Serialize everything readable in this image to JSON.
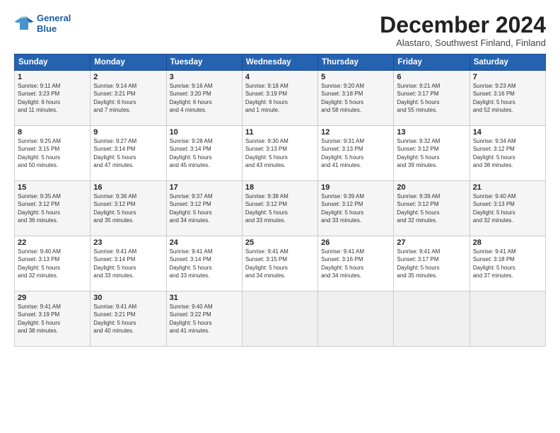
{
  "logo": {
    "line1": "General",
    "line2": "Blue"
  },
  "title": "December 2024",
  "subtitle": "Alastaro, Southwest Finland, Finland",
  "weekdays": [
    "Sunday",
    "Monday",
    "Tuesday",
    "Wednesday",
    "Thursday",
    "Friday",
    "Saturday"
  ],
  "weeks": [
    [
      {
        "day": "1",
        "info": "Sunrise: 9:11 AM\nSunset: 3:23 PM\nDaylight: 6 hours\nand 11 minutes."
      },
      {
        "day": "2",
        "info": "Sunrise: 9:14 AM\nSunset: 3:21 PM\nDaylight: 6 hours\nand 7 minutes."
      },
      {
        "day": "3",
        "info": "Sunrise: 9:16 AM\nSunset: 3:20 PM\nDaylight: 6 hours\nand 4 minutes."
      },
      {
        "day": "4",
        "info": "Sunrise: 9:18 AM\nSunset: 3:19 PM\nDaylight: 6 hours\nand 1 minute."
      },
      {
        "day": "5",
        "info": "Sunrise: 9:20 AM\nSunset: 3:18 PM\nDaylight: 5 hours\nand 58 minutes."
      },
      {
        "day": "6",
        "info": "Sunrise: 9:21 AM\nSunset: 3:17 PM\nDaylight: 5 hours\nand 55 minutes."
      },
      {
        "day": "7",
        "info": "Sunrise: 9:23 AM\nSunset: 3:16 PM\nDaylight: 5 hours\nand 52 minutes."
      }
    ],
    [
      {
        "day": "8",
        "info": "Sunrise: 9:25 AM\nSunset: 3:15 PM\nDaylight: 5 hours\nand 50 minutes."
      },
      {
        "day": "9",
        "info": "Sunrise: 9:27 AM\nSunset: 3:14 PM\nDaylight: 5 hours\nand 47 minutes."
      },
      {
        "day": "10",
        "info": "Sunrise: 9:28 AM\nSunset: 3:14 PM\nDaylight: 5 hours\nand 45 minutes."
      },
      {
        "day": "11",
        "info": "Sunrise: 9:30 AM\nSunset: 3:13 PM\nDaylight: 5 hours\nand 43 minutes."
      },
      {
        "day": "12",
        "info": "Sunrise: 9:31 AM\nSunset: 3:13 PM\nDaylight: 5 hours\nand 41 minutes."
      },
      {
        "day": "13",
        "info": "Sunrise: 9:32 AM\nSunset: 3:12 PM\nDaylight: 5 hours\nand 39 minutes."
      },
      {
        "day": "14",
        "info": "Sunrise: 9:34 AM\nSunset: 3:12 PM\nDaylight: 5 hours\nand 38 minutes."
      }
    ],
    [
      {
        "day": "15",
        "info": "Sunrise: 9:35 AM\nSunset: 3:12 PM\nDaylight: 5 hours\nand 36 minutes."
      },
      {
        "day": "16",
        "info": "Sunrise: 9:36 AM\nSunset: 3:12 PM\nDaylight: 5 hours\nand 35 minutes."
      },
      {
        "day": "17",
        "info": "Sunrise: 9:37 AM\nSunset: 3:12 PM\nDaylight: 5 hours\nand 34 minutes."
      },
      {
        "day": "18",
        "info": "Sunrise: 9:38 AM\nSunset: 3:12 PM\nDaylight: 5 hours\nand 33 minutes."
      },
      {
        "day": "19",
        "info": "Sunrise: 9:39 AM\nSunset: 3:12 PM\nDaylight: 5 hours\nand 33 minutes."
      },
      {
        "day": "20",
        "info": "Sunrise: 9:39 AM\nSunset: 3:12 PM\nDaylight: 5 hours\nand 32 minutes."
      },
      {
        "day": "21",
        "info": "Sunrise: 9:40 AM\nSunset: 3:13 PM\nDaylight: 5 hours\nand 32 minutes."
      }
    ],
    [
      {
        "day": "22",
        "info": "Sunrise: 9:40 AM\nSunset: 3:13 PM\nDaylight: 5 hours\nand 32 minutes."
      },
      {
        "day": "23",
        "info": "Sunrise: 9:41 AM\nSunset: 3:14 PM\nDaylight: 5 hours\nand 33 minutes."
      },
      {
        "day": "24",
        "info": "Sunrise: 9:41 AM\nSunset: 3:14 PM\nDaylight: 5 hours\nand 33 minutes."
      },
      {
        "day": "25",
        "info": "Sunrise: 9:41 AM\nSunset: 3:15 PM\nDaylight: 5 hours\nand 34 minutes."
      },
      {
        "day": "26",
        "info": "Sunrise: 9:41 AM\nSunset: 3:16 PM\nDaylight: 5 hours\nand 34 minutes."
      },
      {
        "day": "27",
        "info": "Sunrise: 9:41 AM\nSunset: 3:17 PM\nDaylight: 5 hours\nand 35 minutes."
      },
      {
        "day": "28",
        "info": "Sunrise: 9:41 AM\nSunset: 3:18 PM\nDaylight: 5 hours\nand 37 minutes."
      }
    ],
    [
      {
        "day": "29",
        "info": "Sunrise: 9:41 AM\nSunset: 3:19 PM\nDaylight: 5 hours\nand 38 minutes."
      },
      {
        "day": "30",
        "info": "Sunrise: 9:41 AM\nSunset: 3:21 PM\nDaylight: 5 hours\nand 40 minutes."
      },
      {
        "day": "31",
        "info": "Sunrise: 9:40 AM\nSunset: 3:22 PM\nDaylight: 5 hours\nand 41 minutes."
      },
      {
        "day": "",
        "info": ""
      },
      {
        "day": "",
        "info": ""
      },
      {
        "day": "",
        "info": ""
      },
      {
        "day": "",
        "info": ""
      }
    ]
  ]
}
